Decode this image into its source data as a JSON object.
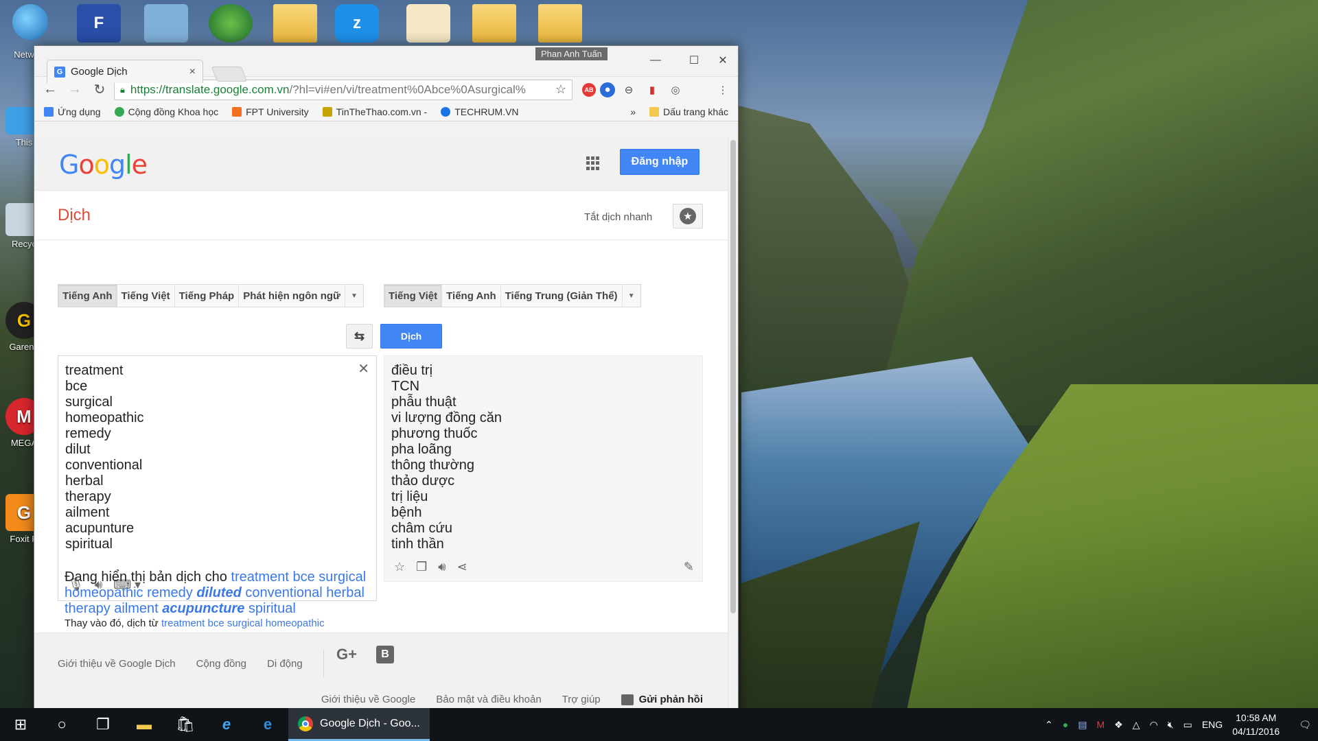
{
  "desktop": {
    "left_icons": [
      {
        "label": "Netw",
        "icon": "network-icon"
      },
      {
        "label": "This",
        "icon": "this-pc-icon"
      },
      {
        "label": "Recyc",
        "icon": "recycle-bin-icon"
      },
      {
        "label": "Garena",
        "icon": "garena-icon"
      },
      {
        "label": "MEGA",
        "icon": "mega-icon"
      },
      {
        "label": "Foxit R",
        "icon": "foxit-reader-icon"
      }
    ]
  },
  "browser": {
    "tab_title": "Google Dịch",
    "profile_name": "Phan Anh Tuấn",
    "url_host": "https://translate.google.com.vn",
    "url_path": "/?hl=vi#en/vi/treatment%0Abce%0Asurgical%",
    "bookmarks": [
      {
        "label": "Ứng dụng",
        "color": "#4285f4"
      },
      {
        "label": "Cộng đồng Khoa học",
        "color": "#34a853"
      },
      {
        "label": "FPT University",
        "color": "#f37021"
      },
      {
        "label": "TinTheThao.com.vn -",
        "color": "#c8a400"
      },
      {
        "label": "TECHRUM.VN",
        "color": "#1a73e8"
      }
    ],
    "bookmarks_overflow": "»",
    "other_bookmarks": "Dấu trang khác"
  },
  "translate": {
    "signin_label": "Đăng nhập",
    "page_title": "Dịch",
    "instant_off": "Tắt dịch nhanh",
    "source_langs": [
      "Tiếng Anh",
      "Tiếng Việt",
      "Tiếng Pháp",
      "Phát hiện ngôn ngữ"
    ],
    "target_langs": [
      "Tiếng Việt",
      "Tiếng Anh",
      "Tiếng Trung (Giản Thể)"
    ],
    "translate_button": "Dịch",
    "source_lines": [
      "treatment",
      "bce",
      "surgical",
      "homeopathic",
      "remedy",
      "dilut",
      "conventional",
      "herbal",
      "therapy",
      "ailment",
      "acupunture",
      "spiritual"
    ],
    "result_lines": [
      "điều trị",
      "TCN",
      "phẫu thuật",
      "vi lượng đồng căn",
      "phương thuốc",
      "pha loãng",
      "thông thường",
      "thảo dược",
      "trị liệu",
      "bệnh",
      "châm cứu",
      "tinh thần"
    ],
    "correction": {
      "prefix": "Đang hiển thị bản dịch cho ",
      "part1": "treatment bce surgical homeopathic remedy ",
      "bold1": "diluted",
      "part2": " conventional herbal therapy ailment ",
      "bold2": "acupuncture",
      "part3": " spiritual"
    },
    "instead": {
      "prefix": "Thay vào đó, dịch từ ",
      "link": "treatment bce surgical homeopathic"
    }
  },
  "footer": {
    "links": [
      "Giới thiệu về Google Dịch",
      "Cộng đồng",
      "Di động"
    ],
    "gplus": "G+",
    "blogger": "B",
    "bottom_links": [
      "Giới thiệu về Google",
      "Bảo mật và điều khoản",
      "Trợ giúp"
    ],
    "feedback": "Gửi phản hồi"
  },
  "taskbar": {
    "active_app": "Google Dịch - Goo...",
    "language": "ENG",
    "time": "10:58 AM",
    "date": "04/11/2016"
  }
}
